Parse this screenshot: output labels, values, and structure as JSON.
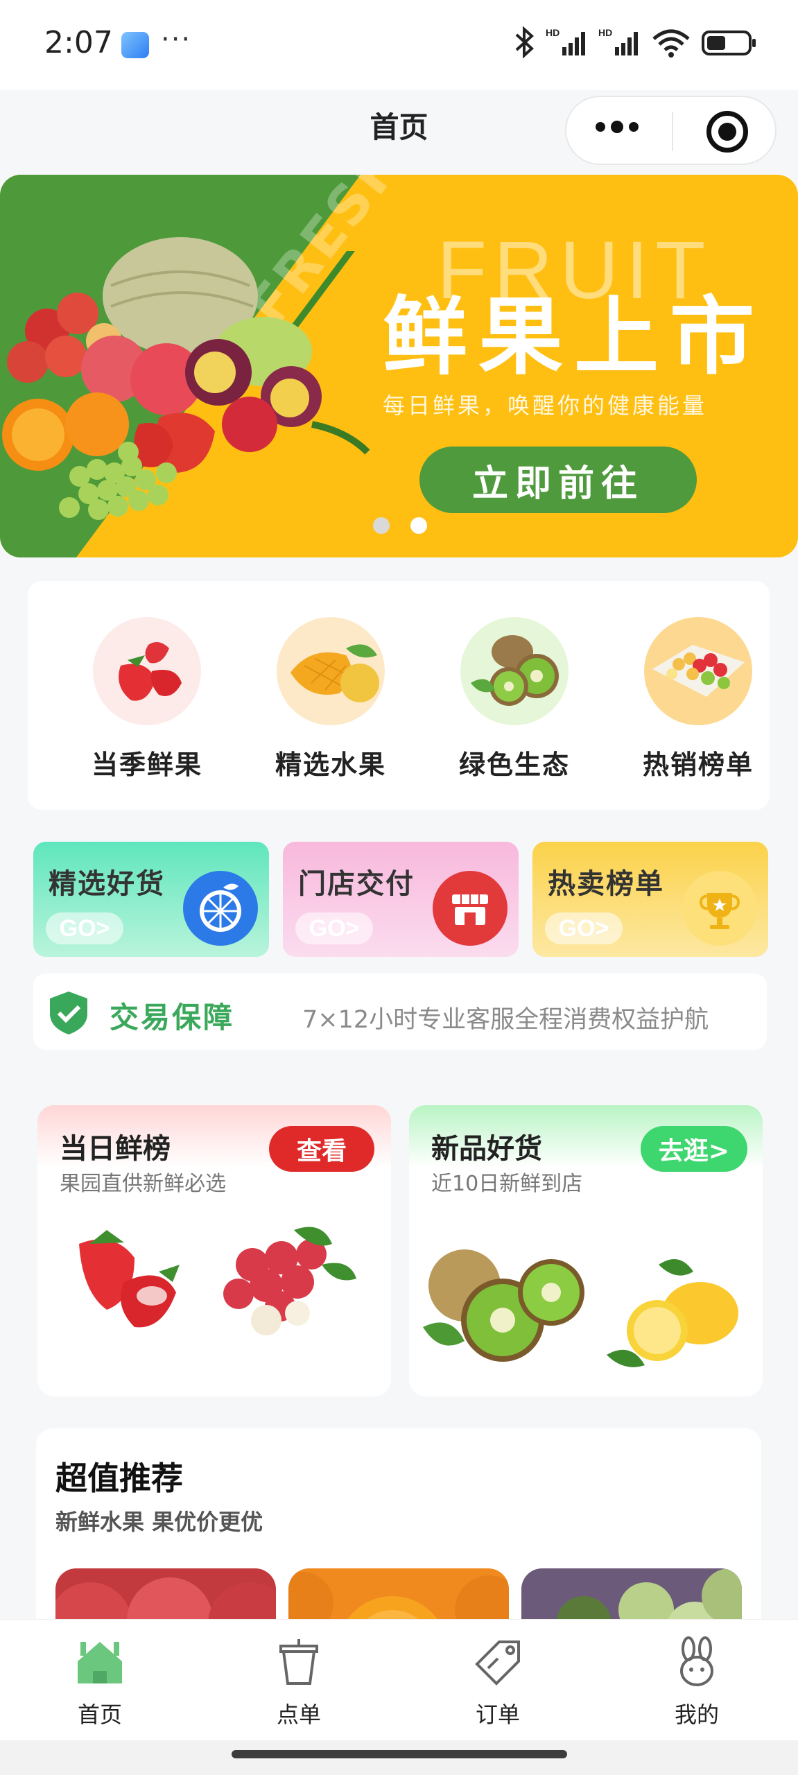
{
  "status_bar": {
    "time": "2:07",
    "dots": "···",
    "battery_percent": 40
  },
  "header": {
    "title": "首页"
  },
  "banner": {
    "watermark_fresh": "FRESH",
    "watermark_fruit": "FRUIT",
    "title": "鲜果上市",
    "subtitle": "每日鲜果，唤醒你的健康能量",
    "cta": "立即前往",
    "dot_count": 2,
    "active_dot": 2
  },
  "categories": [
    {
      "label": "当季鲜果",
      "icon": "strawberry-icon"
    },
    {
      "label": "精选水果",
      "icon": "mango-icon"
    },
    {
      "label": "绿色生态",
      "icon": "kiwi-icon"
    },
    {
      "label": "热销榜单",
      "icon": "fruit-tray-icon"
    }
  ],
  "promos": [
    {
      "title": "精选好货",
      "go": "GO>",
      "icon": "orange-slice-icon"
    },
    {
      "title": "门店交付",
      "go": "GO>",
      "icon": "store-icon"
    },
    {
      "title": "热卖榜单",
      "go": "GO>",
      "icon": "trophy-icon"
    }
  ],
  "guarantee": {
    "title": "交易保障",
    "text": "7×12小时专业客服全程消费权益护航",
    "icon": "shield-check-icon"
  },
  "cards": [
    {
      "title": "当日鲜榜",
      "subtitle": "果园直供新鲜必选",
      "button": "查看"
    },
    {
      "title": "新品好货",
      "subtitle": "近10日新鲜到店",
      "button": "去逛>"
    }
  ],
  "recommend": {
    "title": "超值推荐",
    "subtitle": "新鲜水果 果优价更优"
  },
  "tabs": [
    {
      "label": "首页",
      "icon": "home-icon"
    },
    {
      "label": "点单",
      "icon": "cup-icon"
    },
    {
      "label": "订单",
      "icon": "tag-icon"
    },
    {
      "label": "我的",
      "icon": "rabbit-icon"
    }
  ],
  "colors": {
    "accent_green": "#4e9a3a",
    "banner_yellow": "#ffbf12",
    "red": "#e23a32",
    "bright_green": "#3ed66e"
  }
}
